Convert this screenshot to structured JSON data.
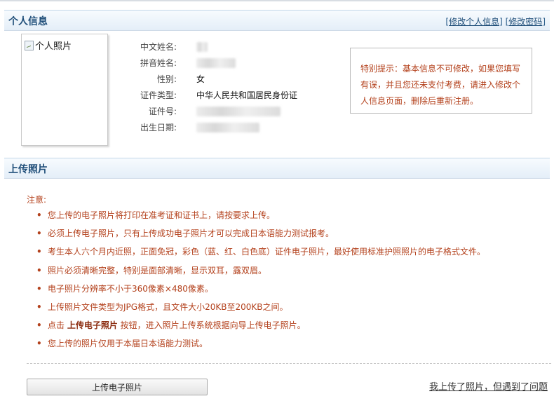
{
  "personal": {
    "title": "个人信息",
    "links": {
      "edit_info": "修改个人信息",
      "edit_password": "修改密码",
      "open_bracket": "[",
      "close_bracket": "]"
    },
    "photo_alt": "个人照片",
    "labels": {
      "chinese_name": "中文姓名:",
      "pinyin_name": "拼音姓名:",
      "gender": "性别:",
      "id_type": "证件类型:",
      "id_number": "证件号:",
      "birth_date": "出生日期:"
    },
    "values": {
      "gender": "女",
      "id_type": "中华人民共和国居民身份证"
    },
    "notice": "特别提示：基本信息不可修改，如果您填写有误，并且您还未支付考费，请进入修改个人信息页面，删除后重新注册。"
  },
  "upload": {
    "title": "上传照片",
    "attention": "注意:",
    "rules": [
      "您上传的电子照片将打印在准考证和证书上，请按要求上传。",
      "必须上传电子照片，只有上传成功电子照片才可以完成日本语能力测试报考。",
      "考生本人六个月内近照，正面免冠，彩色（蓝、红、白色底）证件电子照片，最好使用标准护照照片的电子格式文件。",
      "照片必须清晰完整，特别是面部清晰，显示双耳，露双眉。",
      "电子照片分辨率不小于360像素×480像素。",
      "上传照片文件类型为JPG格式，且文件大小20KB至200KB之间。",
      "您上传的照片仅用于本届日本语能力测试。"
    ],
    "rule_click": {
      "prefix": "点击 ",
      "bold": "上传电子照片",
      "suffix": " 按钮，进入照片上传系统根据向导上传电子照片。"
    },
    "button_label": "上传电子照片",
    "help_link": "我上传了照片，但遇到了问题"
  },
  "colors": {
    "header_title": "#1f4e79",
    "notice_text": "#b3401b"
  }
}
